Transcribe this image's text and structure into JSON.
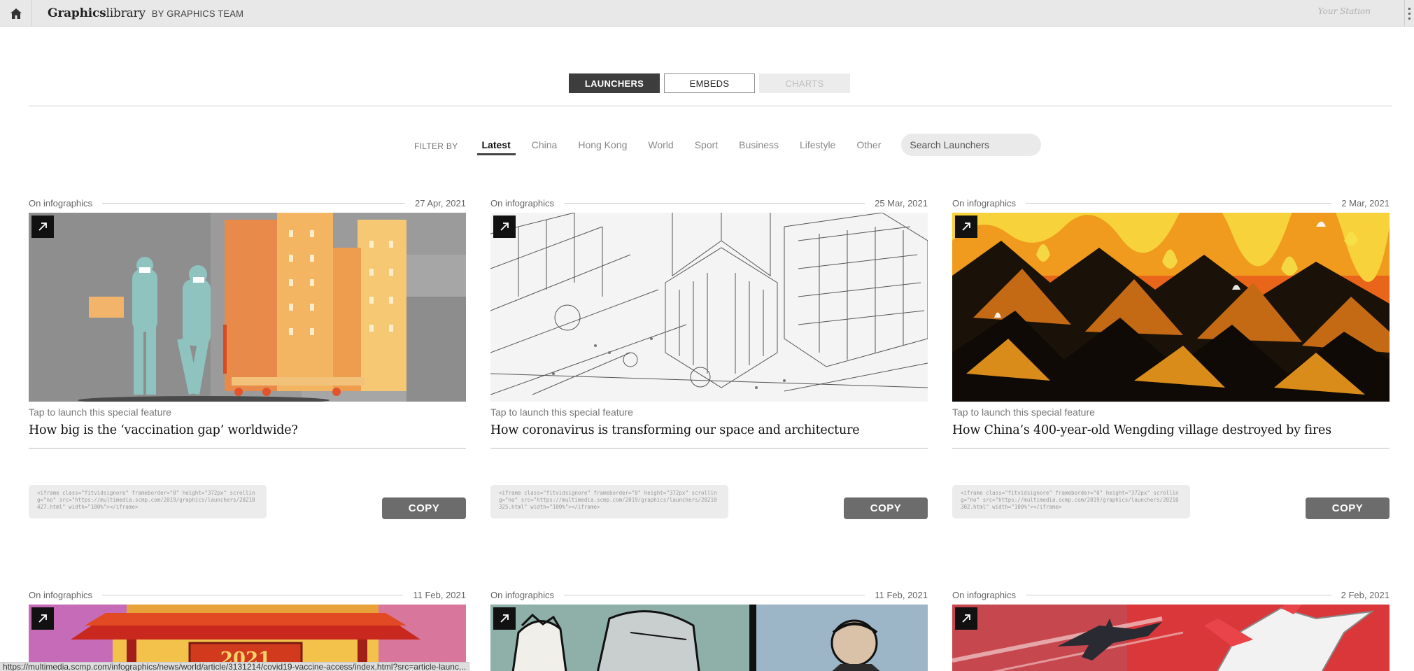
{
  "topbar": {
    "brand_bold": "Graphics",
    "brand_light": "library",
    "brand_by": "BY GRAPHICS TEAM",
    "signature": "Your Station"
  },
  "mode_tabs": [
    {
      "label": "LAUNCHERS",
      "state": "active"
    },
    {
      "label": "EMBEDS",
      "state": "normal"
    },
    {
      "label": "CHARTS",
      "state": "disabled"
    }
  ],
  "filters": {
    "label": "FILTER BY",
    "items": [
      "Latest",
      "China",
      "Hong Kong",
      "World",
      "Sport",
      "Business",
      "Lifestyle",
      "Other"
    ],
    "active": "Latest",
    "search_placeholder": "Search Launchers"
  },
  "tap_text": "Tap to launch this special feature",
  "copy_label": "COPY",
  "cards": [
    {
      "category": "On infographics",
      "date": "27 Apr, 2021",
      "title": "How big is the ‘vaccination gap’ worldwide?",
      "embed": "<iframe class=\"fitvidsignore\" frameborder=\"0\" height=\"372px\" scrolling=\"no\" src=\"https://multimedia.scmp.com/2019/graphics/launchers/20210427.html\" width=\"100%\"></iframe>"
    },
    {
      "category": "On infographics",
      "date": "25 Mar, 2021",
      "title": "How coronavirus is transforming our space and architecture",
      "embed": "<iframe class=\"fitvidsignore\" frameborder=\"0\" height=\"372px\" scrolling=\"no\" src=\"https://multimedia.scmp.com/2019/graphics/launchers/20210325.html\" width=\"100%\"></iframe>"
    },
    {
      "category": "On infographics",
      "date": "2 Mar, 2021",
      "title": "How China’s 400-year-old Wengding village destroyed by fires",
      "embed": "<iframe class=\"fitvidsignore\" frameborder=\"0\" height=\"372px\" scrolling=\"no\" src=\"https://multimedia.scmp.com/2019/graphics/launchers/20210302.html\" width=\"100%\"></iframe>"
    },
    {
      "category": "On infographics",
      "date": "11 Feb, 2021",
      "thumb_text": "2021"
    },
    {
      "category": "On infographics",
      "date": "11 Feb, 2021"
    },
    {
      "category": "On infographics",
      "date": "2 Feb, 2021"
    }
  ],
  "status_url": "https://multimedia.scmp.com/infographics/news/world/article/3131214/covid19-vaccine-access/index.html?src=article-launc..."
}
